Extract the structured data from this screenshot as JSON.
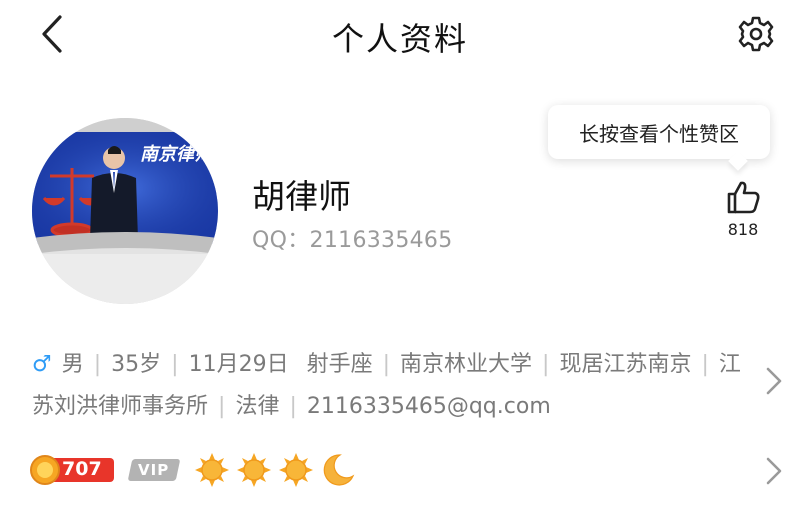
{
  "header": {
    "title": "个人资料",
    "back_icon": "chevron-left-icon",
    "settings_icon": "gear-icon"
  },
  "profile": {
    "avatar_banner_text": "南京律师团",
    "name": "胡律师",
    "qq_label": "QQ：",
    "qq_number": "2116335465"
  },
  "tooltip": {
    "text": "长按查看个性赞区"
  },
  "like": {
    "icon": "thumbs-up-icon",
    "count": "818"
  },
  "info": {
    "gender_symbol": "♂",
    "gender": "男",
    "age": "35岁",
    "birthday": "11月29日",
    "zodiac": "射手座",
    "school": "南京林业大学",
    "location": "现居江苏南京",
    "company": "江苏刘洪律师事务所",
    "industry": "法律",
    "email": "2116335465@qq.com"
  },
  "level": {
    "level_number": "707",
    "vip_label": "VIP",
    "icons": [
      "sun-icon",
      "sun-icon",
      "sun-icon",
      "moon-icon"
    ]
  },
  "colors": {
    "gender_blue": "#2f9cf6",
    "level_red": "#e8352a",
    "sun_orange": "#f6a623",
    "vip_gray": "#b3b3b3",
    "secondary_text": "#9a9a9a"
  }
}
